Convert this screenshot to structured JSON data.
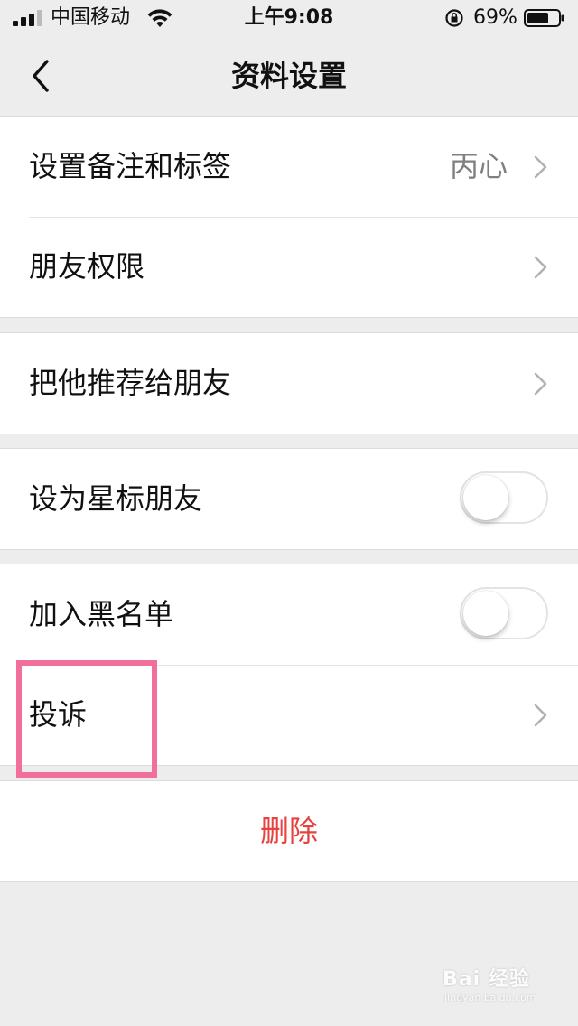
{
  "status_bar": {
    "carrier": "中国移动",
    "time": "上午9:08",
    "battery": "69%",
    "icons": [
      "signal-icon",
      "wifi-icon",
      "orientation-lock-icon",
      "battery-icon"
    ]
  },
  "nav": {
    "title": "资料设置",
    "back_icon": "chevron-left-icon"
  },
  "groups": {
    "g1": {
      "remark": {
        "label": "设置备注和标签",
        "value": "丙心"
      },
      "permission": {
        "label": "朋友权限"
      }
    },
    "g2": {
      "recommend": {
        "label": "把他推荐给朋友"
      }
    },
    "g3": {
      "star": {
        "label": "设为星标朋友",
        "toggle_on": false
      }
    },
    "g4": {
      "blacklist": {
        "label": "加入黑名单",
        "toggle_on": false
      },
      "complain": {
        "label": "投诉"
      }
    },
    "g5": {
      "delete": {
        "label": "删除"
      }
    }
  },
  "colors": {
    "background": "#ededed",
    "delete_text": "#e64340",
    "highlight": "#f0709b"
  },
  "watermark": {
    "text": "Bai 经验",
    "sub": "jingyan.baidu.com"
  }
}
